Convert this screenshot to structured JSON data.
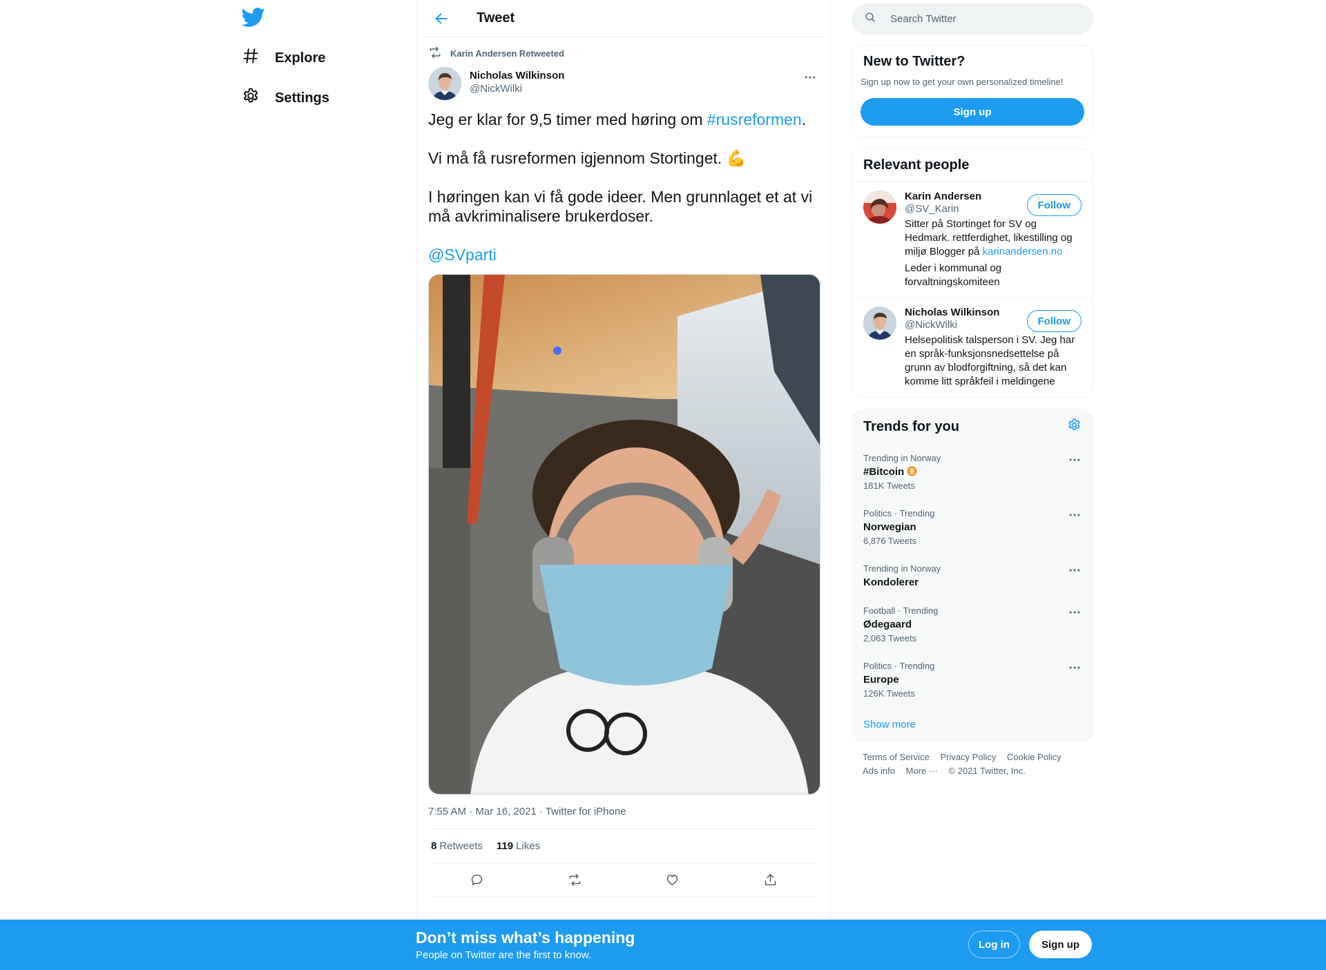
{
  "nav": {
    "logo": "twitter-bird-icon",
    "items": [
      {
        "label": "Explore",
        "icon": "hashtag-icon"
      },
      {
        "label": "Settings",
        "icon": "gear-icon"
      }
    ]
  },
  "header": {
    "title": "Tweet"
  },
  "tweet": {
    "retweeted_by": "Karin Andersen Retweeted",
    "author_name": "Nicholas Wilkinson",
    "author_handle": "@NickWilki",
    "text_line1_prefix": "Jeg er klar for 9,5 timer med høring om ",
    "hashtag": "#rusreformen",
    "text_line1_suffix": ".",
    "text_line2": "Vi må få rusreformen igjennom Stortinget. 💪",
    "text_line3": "I høringen kan vi få gode ideer. Men grunnlaget et at vi må avkriminalisere brukerdoser.",
    "mention": "@SVparti",
    "meta": "7:55 AM · Mar 16, 2021 · Twitter for iPhone",
    "retweets_count": "8",
    "retweets_label": "Retweets",
    "likes_count": "119",
    "likes_label": "Likes"
  },
  "search": {
    "placeholder": "Search Twitter"
  },
  "new_to_twitter": {
    "title": "New to Twitter?",
    "desc": "Sign up now to get your own personalized timeline!",
    "button": "Sign up"
  },
  "relevant_people": {
    "title": "Relevant people",
    "people": [
      {
        "name": "Karin Andersen",
        "handle": "@SV_Karin",
        "bio_prefix": "Sitter på Stortinget for SV og Hedmark. rettferdighet, likestilling og miljø Blogger på ",
        "bio_link": "karinandersen.no",
        "bio_extra": "Leder i kommunal og forvaltningskomiteen",
        "button": "Follow"
      },
      {
        "name": "Nicholas Wilkinson",
        "handle": "@NickWilki",
        "bio_prefix": "Helsepolitisk talsperson i SV. Jeg har en språk-funksjonsnedsettelse på grunn av blodforgiftning, så det kan komme litt språkfeil i meldingene",
        "button": "Follow"
      }
    ]
  },
  "trends": {
    "title": "Trends for you",
    "items": [
      {
        "context": "Trending in Norway",
        "name": "#Bitcoin",
        "count": "181K Tweets"
      },
      {
        "context": "Politics · Trending",
        "name": "Norwegian",
        "count": "6,876 Tweets"
      },
      {
        "context": "Trending in Norway",
        "name": "Kondolerer",
        "count": ""
      },
      {
        "context": "Football · Trending",
        "name": "Ødegaard",
        "count": "2,063 Tweets"
      },
      {
        "context": "Politics · Trending",
        "name": "Europe",
        "count": "126K Tweets"
      }
    ],
    "show_more": "Show more"
  },
  "footer": {
    "links": [
      "Terms of Service",
      "Privacy Policy",
      "Cookie Policy",
      "Ads info",
      "More ···"
    ],
    "copyright": "© 2021 Twitter, Inc."
  },
  "bottom_bar": {
    "title": "Don’t miss what’s happening",
    "subtitle": "People on Twitter are the first to know.",
    "login": "Log in",
    "signup": "Sign up"
  },
  "colors": {
    "accent": "#1d9bf0",
    "text": "#0f1419",
    "muted": "#536471",
    "bitcoin": "#f7931a"
  }
}
